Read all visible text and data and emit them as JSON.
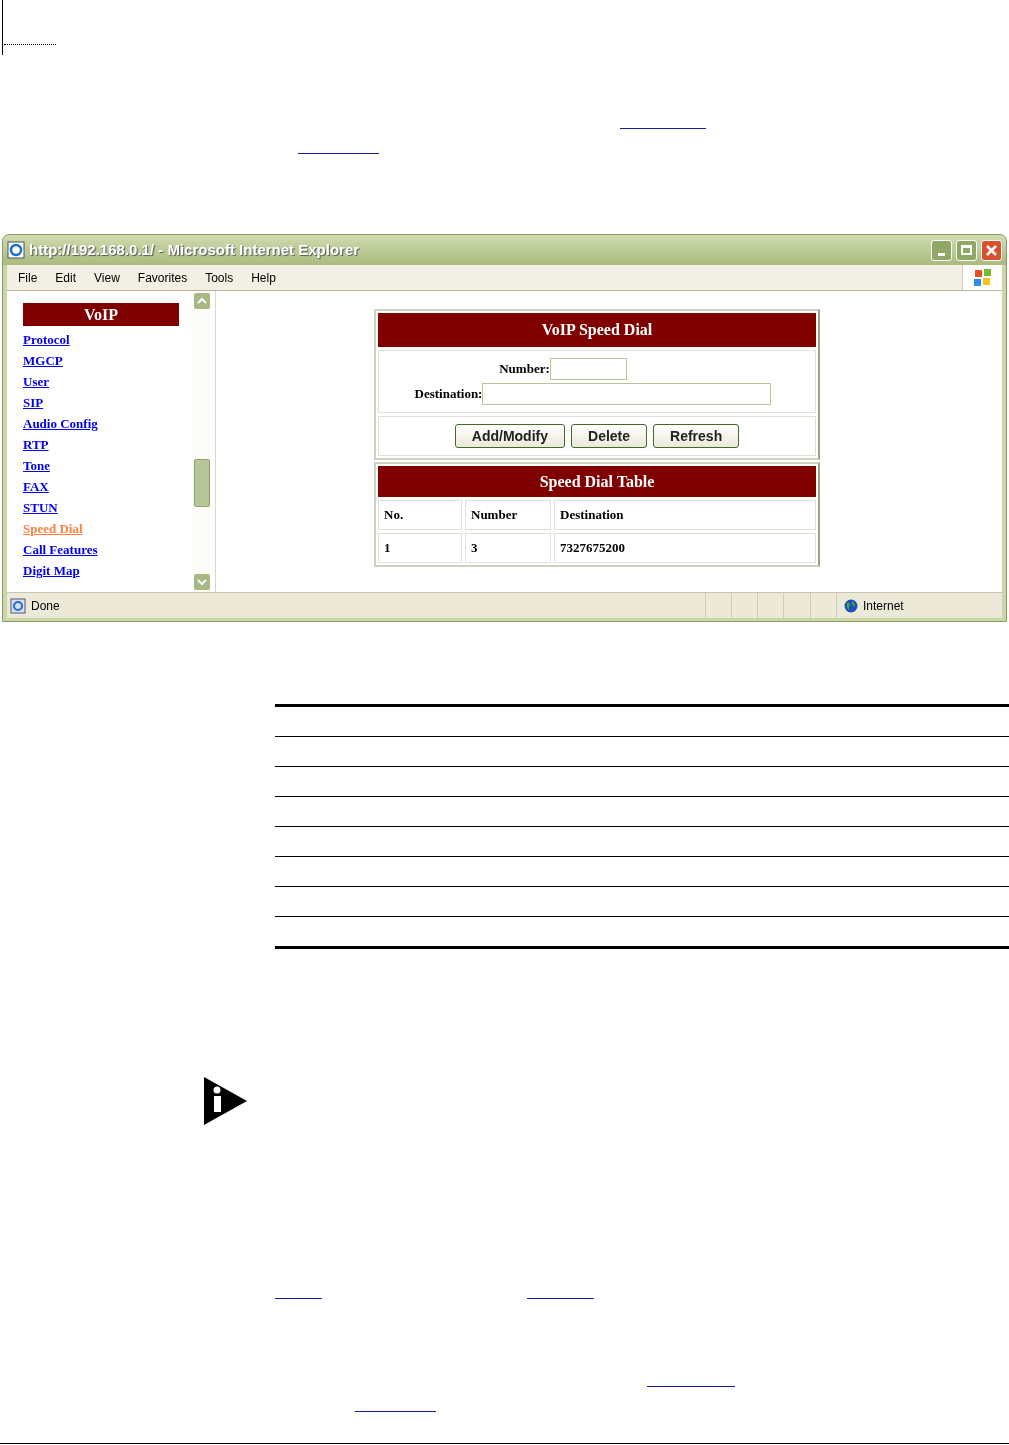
{
  "window": {
    "title": "http://192.168.0.1/ - Microsoft Internet Explorer"
  },
  "menu": [
    "File",
    "Edit",
    "View",
    "Favorites",
    "Tools",
    "Help"
  ],
  "sidebar": {
    "heading": "VoIP",
    "items": [
      {
        "label": "Protocol",
        "selected": false
      },
      {
        "label": "MGCP",
        "selected": false
      },
      {
        "label": "User",
        "selected": false
      },
      {
        "label": "SIP",
        "selected": false
      },
      {
        "label": "Audio Config",
        "selected": false
      },
      {
        "label": "RTP",
        "selected": false
      },
      {
        "label": "Tone",
        "selected": false
      },
      {
        "label": "FAX",
        "selected": false
      },
      {
        "label": "STUN",
        "selected": false
      },
      {
        "label": "Speed Dial",
        "selected": true
      },
      {
        "label": "Call Features",
        "selected": false
      },
      {
        "label": "Digit Map",
        "selected": false
      }
    ]
  },
  "form": {
    "title": "VoIP Speed Dial",
    "fields": [
      {
        "label": "Number:",
        "kind": "short"
      },
      {
        "label": "Destination:",
        "kind": "long"
      }
    ],
    "buttons": [
      "Add/Modify",
      "Delete",
      "Refresh"
    ]
  },
  "table": {
    "title": "Speed Dial Table",
    "columns": [
      "No.",
      "Number",
      "Destination"
    ],
    "rows": [
      [
        "1",
        "3",
        "7327675200"
      ]
    ]
  },
  "status_bar": {
    "text": "Done",
    "zone": "Internet"
  }
}
